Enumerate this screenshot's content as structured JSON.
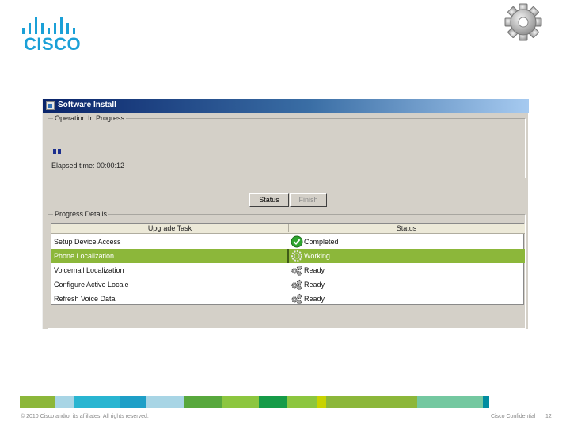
{
  "brand": {
    "logo_text": "CISCO",
    "logo_color": "#1ba0d7"
  },
  "window": {
    "title": "Software Install",
    "operation_group_label": "Operation In Progress",
    "progress_fraction": 0.02,
    "elapsed_text": "Elapsed time: 00:00:12",
    "buttons": {
      "status": "Status",
      "finish": "Finish"
    },
    "details_group_label": "Progress Details",
    "table": {
      "headers": [
        "Upgrade Task",
        "Status"
      ],
      "rows": [
        {
          "task": "Setup Device Access",
          "status": "Completed",
          "icon": "check-icon",
          "selected": false
        },
        {
          "task": "Phone Localization",
          "status": "Working...",
          "icon": "spinner-icon",
          "selected": true
        },
        {
          "task": "Voicemail Localization",
          "status": "Ready",
          "icon": "gears-icon",
          "selected": false
        },
        {
          "task": "Configure Active Locale",
          "status": "Ready",
          "icon": "gears-icon",
          "selected": false
        },
        {
          "task": "Refresh Voice Data",
          "status": "Ready",
          "icon": "gears-icon",
          "selected": false
        }
      ]
    },
    "colors": {
      "selection": "#8cb73a",
      "titlebar": "#0a246a"
    }
  },
  "footer": {
    "copyright": "© 2010 Cisco and/or its affiliates. All rights reserved.",
    "confidential": "Cisco Confidential",
    "page_number": "12",
    "stripe_colors": [
      "#8cb73a",
      "#a8d5e5",
      "#29b5d1",
      "#1e9fc7",
      "#a8d5e5",
      "#58a83d",
      "#8cc63f",
      "#169b48",
      "#8cc63f",
      "#c8d300",
      "#8cb73a",
      "#74c8a0",
      "#008ca0"
    ]
  }
}
